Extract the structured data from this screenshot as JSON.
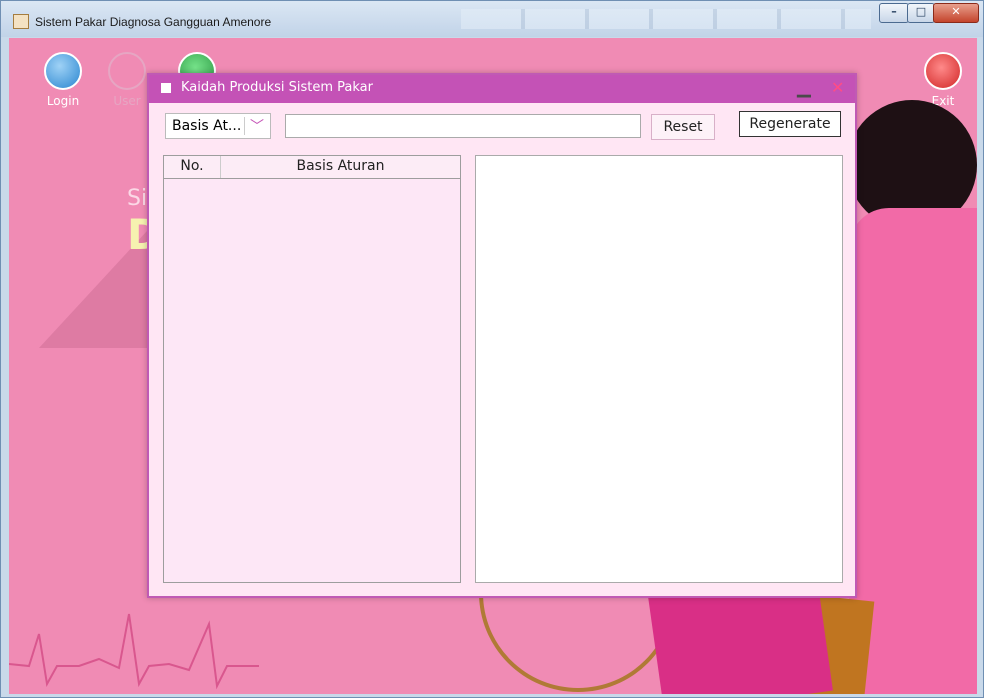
{
  "window": {
    "title": "Sistem Pakar Diagnosa Gangguan Amenore"
  },
  "toolbar": {
    "login_label": "Login",
    "user_label": "User",
    "exit_label": "Exit"
  },
  "dialog": {
    "title": "Kaidah Produksi Sistem Pakar",
    "combo_value": "Basis At...",
    "search_value": "",
    "reset_label": "Reset",
    "regenerate_label": "Regenerate",
    "table": {
      "columns": [
        "No.",
        "Basis Aturan"
      ],
      "rows": []
    },
    "detail_text": ""
  },
  "background": {
    "title_fragment_small": "Si",
    "title_fragment_large": "D"
  },
  "colors": {
    "background_pink": "#f08bb4",
    "dialog_bg": "#ffe6f4",
    "dialog_title": "#c452b6"
  }
}
